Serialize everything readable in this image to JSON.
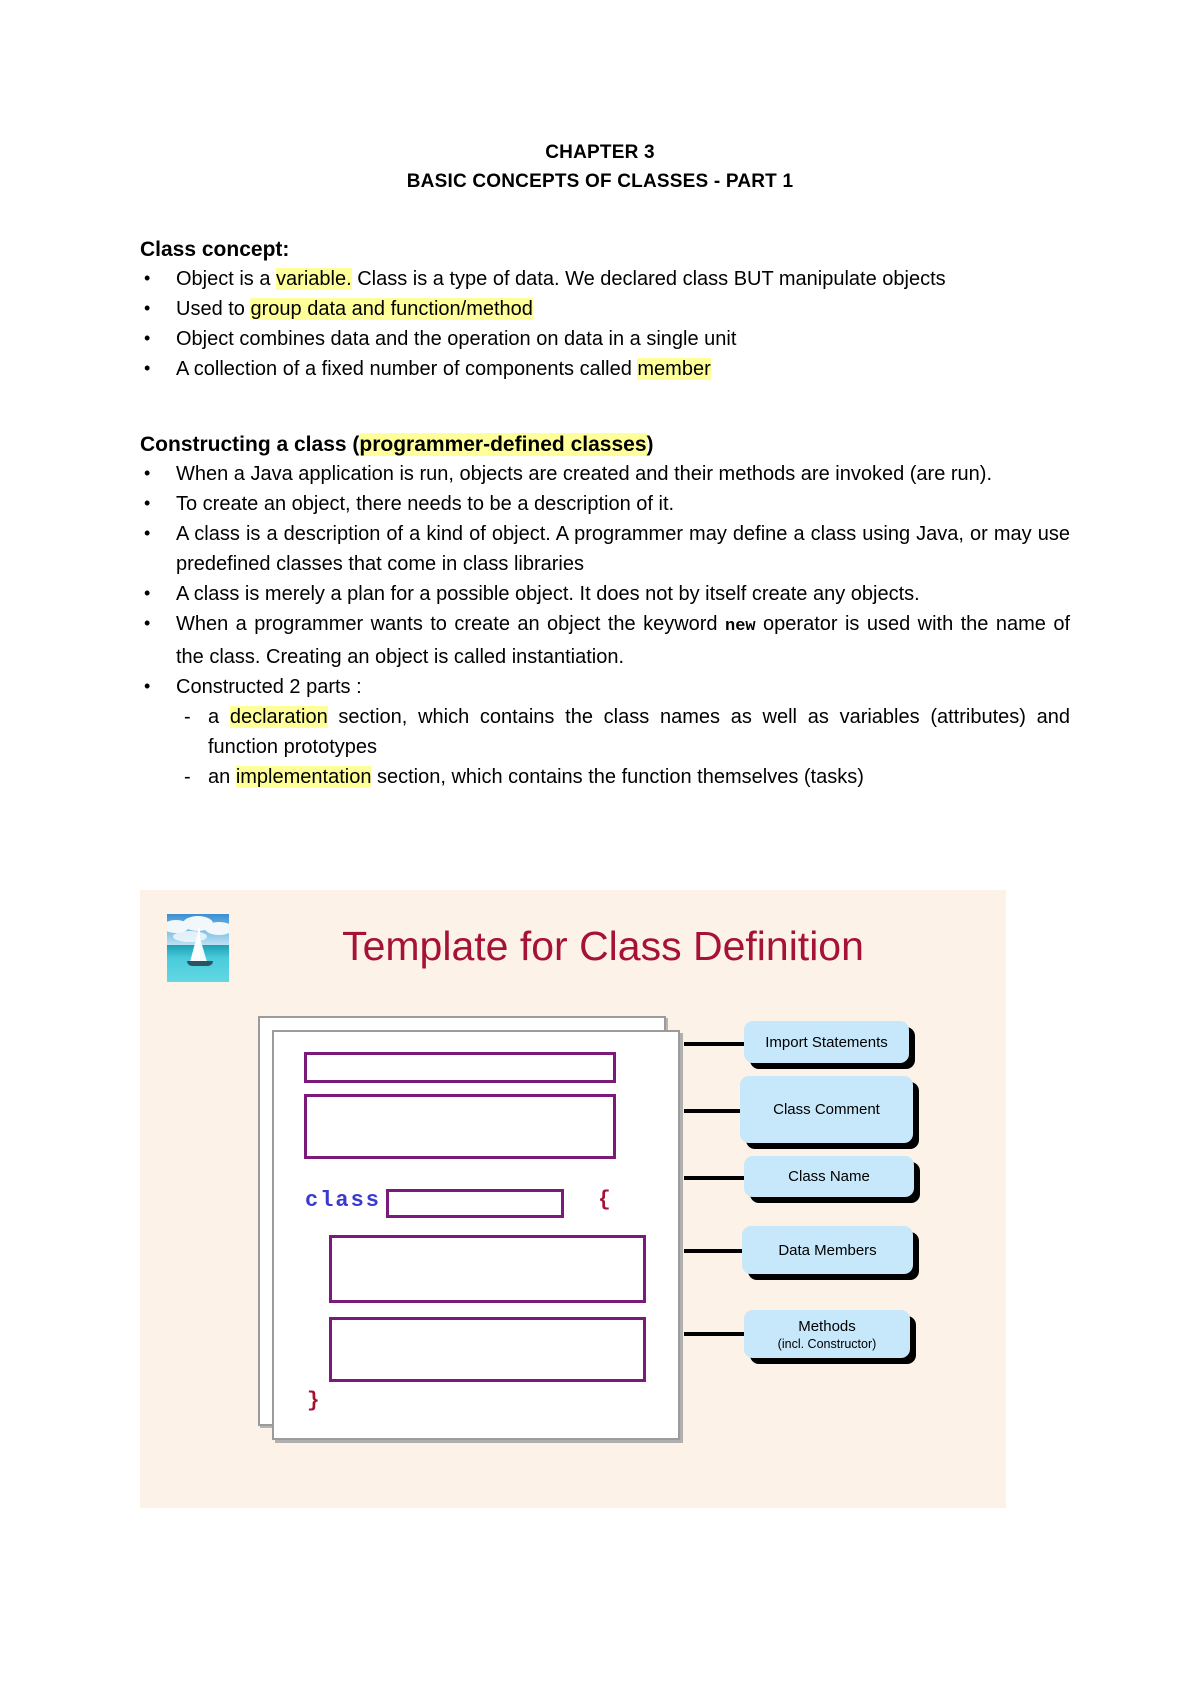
{
  "document": {
    "title_line_1": "CHAPTER 3",
    "title_line_2": "BASIC CONCEPTS OF CLASSES - PART 1"
  },
  "section_class_concept": {
    "heading": "Class concept:",
    "bullets": [
      {
        "pre": "Object is a ",
        "highlight": "variable.",
        "post": " Class is a type of data. We declared class BUT manipulate objects"
      },
      {
        "pre": "Used to ",
        "highlight": "group data and function/method",
        "post": ""
      },
      {
        "pre": "Object combines data and the operation on data in a single unit",
        "highlight": "",
        "post": ""
      },
      {
        "pre": "A collection of a fixed number of components called ",
        "highlight": "member",
        "post": ""
      }
    ]
  },
  "section_constructing": {
    "heading_pre": "Constructing a class (",
    "heading_highlight": "programmer-defined classes",
    "heading_post": ")",
    "bullets": [
      "When a Java application is run, objects are created and their methods are invoked (are run).",
      "To create an object, there needs to be a description of it.",
      "A class is a description of a kind of object. A programmer may define a class using Java, or may use predefined classes that come in class libraries",
      "A class is merely a plan for a possible object. It does not by itself create any objects."
    ],
    "bullet_new": {
      "pre": "When a programmer wants to create an object the keyword ",
      "keyword": "new",
      "post": " operator is used with the name of the class. Creating an object is called instantiation."
    },
    "bullet_parts": "Constructed 2 parts :",
    "sub_bullets": [
      {
        "pre": "a ",
        "highlight": "declaration",
        "post": " section, which contains the class names as well as variables (attributes) and function prototypes"
      },
      {
        "pre": "an ",
        "highlight": "implementation",
        "post": " section, which contains the function themselves (tasks)"
      }
    ]
  },
  "slide": {
    "title": "Template for Class Definition",
    "thumbnail_name": "sailboat-photo",
    "code": {
      "keyword_class": "class",
      "brace_open": "{",
      "brace_close": "}"
    },
    "callouts": [
      {
        "label": "Import Statements",
        "sub": ""
      },
      {
        "label": "Class Comment",
        "sub": ""
      },
      {
        "label": "Class Name",
        "sub": ""
      },
      {
        "label": "Data Members",
        "sub": ""
      },
      {
        "label": "Methods",
        "sub": "(incl. Constructor)"
      }
    ]
  },
  "colors": {
    "highlight": "#ffff99",
    "slide_background": "#fdf2e7",
    "slide_title": "#a61236",
    "code_box_border": "#7b1a7b",
    "code_keyword": "#3a3ad0",
    "code_brace": "#a61236",
    "callout_fill": "#c7e7fb"
  }
}
